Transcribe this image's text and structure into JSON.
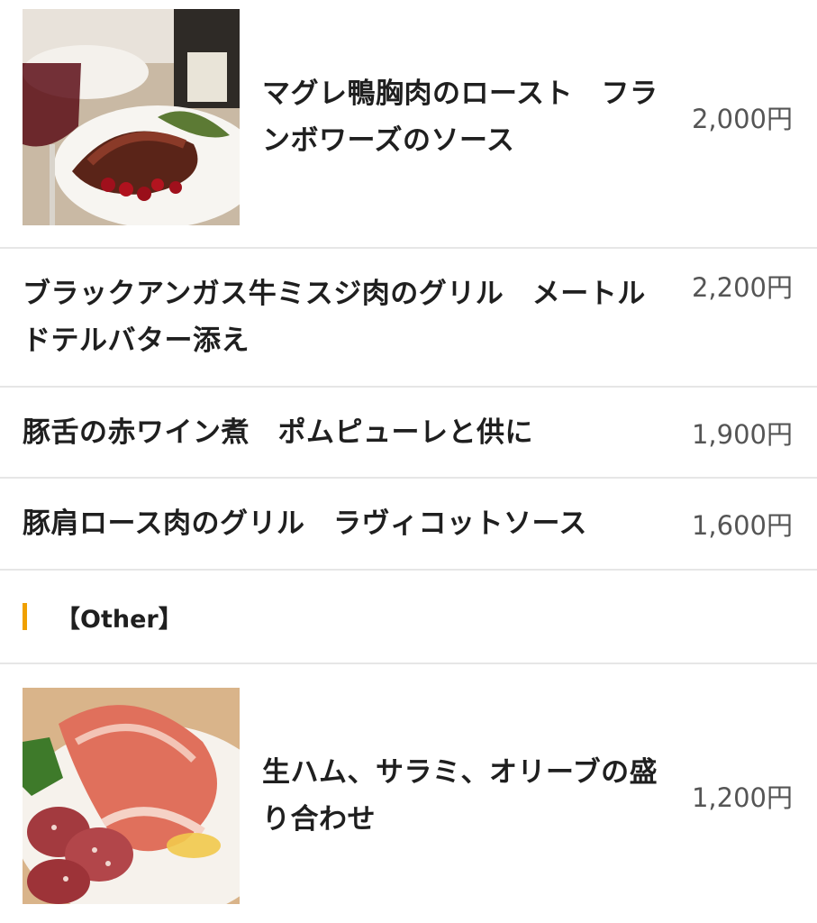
{
  "menu": {
    "items": [
      {
        "name": "マグレ鴨胸肉のロースト　フランボワーズのソース",
        "price": "2,000円",
        "image": "duck-dish-photo"
      },
      {
        "name": "ブラックアンガス牛ミスジ肉のグリル　メートルドテルバター添え",
        "price": "2,200円"
      },
      {
        "name": "豚舌の赤ワイン煮　ポムピューレと供に",
        "price": "1,900円"
      },
      {
        "name": "豚肩ロース肉のグリル　ラヴィコットソース",
        "price": "1,600円"
      }
    ],
    "section": {
      "title": "【Other】",
      "accent_color": "#f0a000"
    },
    "other_items": [
      {
        "name": "生ハム、サラミ、オリーブの盛り合わせ",
        "price": "1,200円",
        "image": "ham-salami-photo"
      }
    ]
  }
}
